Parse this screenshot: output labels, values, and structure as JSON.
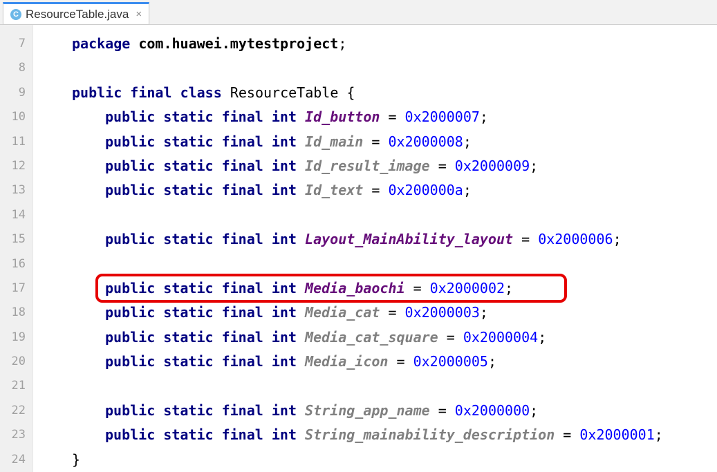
{
  "tab": {
    "icon_letter": "C",
    "filename": "ResourceTable.java",
    "close_glyph": "×"
  },
  "gutter": [
    "7",
    "8",
    "9",
    "10",
    "11",
    "12",
    "13",
    "14",
    "15",
    "16",
    "17",
    "18",
    "19",
    "20",
    "21",
    "22",
    "23",
    "24"
  ],
  "code": {
    "package_kw": "package",
    "package_name": "com.huawei.mytestproject",
    "public_kw": "public",
    "final_kw": "final",
    "class_kw": "class",
    "static_kw": "static",
    "int_kw": "int",
    "class_name": "ResourceTable",
    "open_brace": "{",
    "close_brace": "}",
    "eq": " = ",
    "semi": ";",
    "fields": [
      {
        "name": "Id_button",
        "value": "0x2000007",
        "italic_gray": false
      },
      {
        "name": "Id_main",
        "value": "0x2000008",
        "italic_gray": true
      },
      {
        "name": "Id_result_image",
        "value": "0x2000009",
        "italic_gray": true
      },
      {
        "name": "Id_text",
        "value": "0x200000a",
        "italic_gray": true
      }
    ],
    "layout_field": {
      "name": "Layout_MainAbility_layout",
      "value": "0x2000006"
    },
    "media_fields": [
      {
        "name": "Media_baochi",
        "value": "0x2000002",
        "highlighted": true,
        "italic_gray": false
      },
      {
        "name": "Media_cat",
        "value": "0x2000003",
        "italic_gray": true
      },
      {
        "name": "Media_cat_square",
        "value": "0x2000004",
        "italic_gray": true
      },
      {
        "name": "Media_icon",
        "value": "0x2000005",
        "italic_gray": true
      }
    ],
    "string_fields": [
      {
        "name": "String_app_name",
        "value": "0x2000000"
      },
      {
        "name": "String_mainability_description",
        "value": "0x2000001"
      }
    ]
  }
}
